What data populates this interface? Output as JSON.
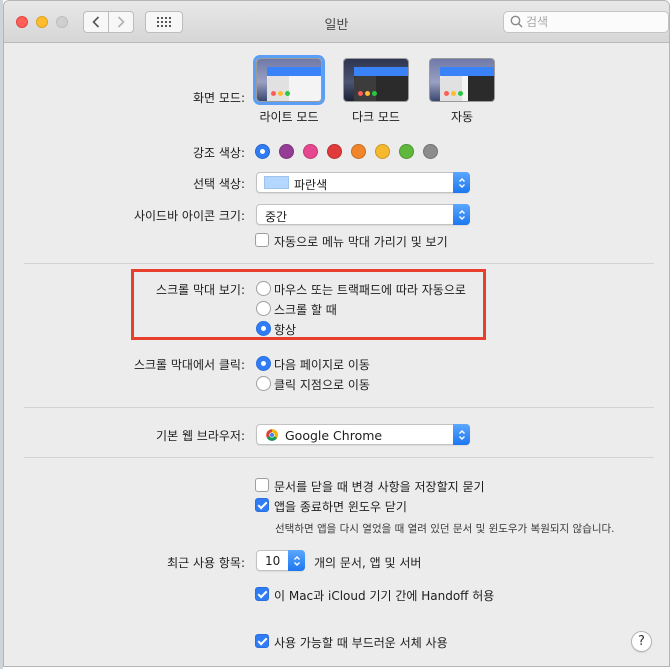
{
  "window": {
    "title": "일반",
    "search_placeholder": "검색"
  },
  "appearance": {
    "label": "화면 모드:",
    "options": [
      {
        "name": "라이트 모드",
        "selected": true
      },
      {
        "name": "다크 모드",
        "selected": false
      },
      {
        "name": "자동",
        "selected": false
      }
    ]
  },
  "accent": {
    "label": "강조 색상:",
    "colors": [
      "#2f7cf6",
      "#953d96",
      "#e6488f",
      "#e03a3a",
      "#f1852c",
      "#f6b92e",
      "#5fb83b",
      "#8c8c8c"
    ],
    "selected_index": 0
  },
  "highlight": {
    "label": "선택 색상:",
    "value": "파란색",
    "swatch": "#b3d7ff"
  },
  "sidebar_icon": {
    "label": "사이드바 아이콘 크기:",
    "value": "중간"
  },
  "autohide_menu": {
    "label": "자동으로 메뉴 막대 가리기 및 보기",
    "checked": false
  },
  "show_scrollbars": {
    "label": "스크롤 막대 보기:",
    "options": [
      {
        "label": "마우스 또는 트랙패드에 따라 자동으로",
        "checked": false
      },
      {
        "label": "스크롤 할 때",
        "checked": false
      },
      {
        "label": "항상",
        "checked": true
      }
    ]
  },
  "click_scrollbar": {
    "label": "스크롤 막대에서 클릭:",
    "options": [
      {
        "label": "다음 페이지로 이동",
        "checked": true
      },
      {
        "label": "클릭 지점으로 이동",
        "checked": false
      }
    ]
  },
  "default_browser": {
    "label": "기본 웹 브라우저:",
    "value": "Google Chrome"
  },
  "close_docs": {
    "ask_label": "문서를 닫을 때 변경 사항을 저장할지 묻기",
    "ask_checked": false,
    "close_windows_label": "앱을 종료하면 윈도우 닫기",
    "close_windows_checked": true,
    "note": "선택하면 앱을 다시 열었을 때 열려 있던 문서 및 윈도우가 복원되지 않습니다."
  },
  "recent_items": {
    "label": "최근 사용 항목:",
    "value": "10",
    "suffix": "개의 문서, 앱 및 서버"
  },
  "handoff": {
    "label": "이 Mac과 iCloud 기기 간에 Handoff 허용",
    "checked": true
  },
  "font_smoothing": {
    "label": "사용 가능할 때 부드러운 서체 사용",
    "checked": true
  },
  "help": "?"
}
